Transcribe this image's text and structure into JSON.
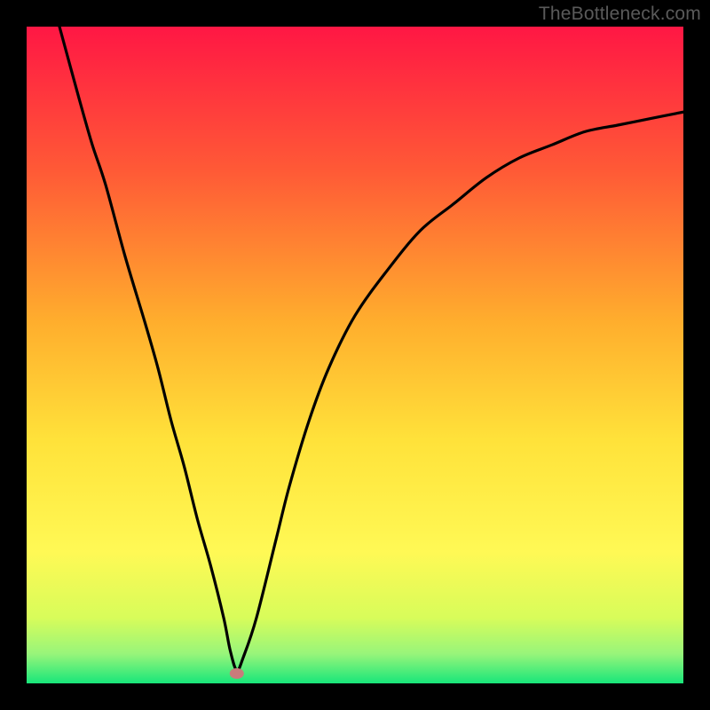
{
  "watermark": "TheBottleneck.com",
  "chart_data": {
    "type": "line",
    "title": "",
    "xlabel": "",
    "ylabel": "",
    "xlim": [
      0,
      100
    ],
    "ylim": [
      0,
      100
    ],
    "grid": false,
    "legend": false,
    "series": [
      {
        "name": "bottleneck-curve",
        "x": [
          5,
          8,
          10,
          12,
          15,
          18,
          20,
          22,
          24,
          26,
          28,
          30,
          31,
          32,
          33,
          35,
          38,
          40,
          43,
          46,
          50,
          55,
          60,
          65,
          70,
          75,
          80,
          85,
          90,
          95,
          100
        ],
        "y": [
          100,
          89,
          82,
          76,
          65,
          55,
          48,
          40,
          33,
          25,
          18,
          10,
          5,
          2,
          4,
          10,
          22,
          30,
          40,
          48,
          56,
          63,
          69,
          73,
          77,
          80,
          82,
          84,
          85,
          86,
          87
        ]
      }
    ],
    "marker": {
      "x": 32,
      "y": 1.5,
      "color": "#c97b7b"
    },
    "gradient_stops": [
      {
        "offset": 0.0,
        "color": "#ff1744"
      },
      {
        "offset": 0.22,
        "color": "#ff5a36"
      },
      {
        "offset": 0.45,
        "color": "#ffae2d"
      },
      {
        "offset": 0.63,
        "color": "#ffe23a"
      },
      {
        "offset": 0.8,
        "color": "#fff955"
      },
      {
        "offset": 0.9,
        "color": "#d8fc5a"
      },
      {
        "offset": 0.955,
        "color": "#98f57a"
      },
      {
        "offset": 1.0,
        "color": "#18e67a"
      }
    ]
  }
}
